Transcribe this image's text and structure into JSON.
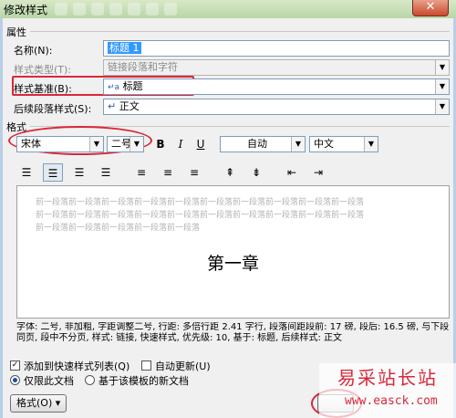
{
  "window": {
    "title": "修改样式",
    "close_icon": "✕"
  },
  "properties": {
    "section_label": "属性",
    "name_label": "名称(N):",
    "name_value": "标题 1",
    "type_label": "样式类型(T):",
    "type_value": "链接段落和字符",
    "based_on_label": "样式基准(B):",
    "based_on_value": "标题",
    "based_on_icon": "paragraph-char-icon",
    "next_label": "后续段落样式(S):",
    "next_value": "正文",
    "next_icon": "paragraph-return-icon"
  },
  "format": {
    "section_label": "格式",
    "font_name": "宋体",
    "font_size": "二号",
    "bold_label": "B",
    "italic_label": "I",
    "underline_label": "U",
    "color_value": "自动",
    "script_value": "中文"
  },
  "preview": {
    "prev_line_1": "前一段落前一段落前一段落前一段落前一段落前一段落前一段落前一段落前一段落前一段落",
    "prev_line_2": "前一段落前一段落前一段落前一段落前一段落前一段落前一段落前一段落前一段落前一段落",
    "prev_line_3": "前一段落前一段落前一段落前一段落前一段落",
    "heading": "第一章"
  },
  "description": "字体: 二号, 非加粗, 字距调整二号, 行距: 多倍行距 2.41 字行, 段落间距段前: 17 磅, 段后: 16.5 磅, 与下段同页, 段中不分页, 样式: 链接, 快速样式, 优先级: 10, 基于: 标题, 后续样式: 正文",
  "options": {
    "add_to_quick": "添加到快速样式列表(Q)",
    "auto_update": "自动更新(U)",
    "only_this_doc": "仅限此文档",
    "new_docs_template": "基于该模板的新文档"
  },
  "buttons": {
    "format_label": "格式(O) ▾"
  },
  "watermark": {
    "logo": "易采站长站",
    "url": "www.easck.com"
  },
  "colors": {
    "highlight_red": "#d9283a",
    "selection_blue": "#3399ff"
  }
}
